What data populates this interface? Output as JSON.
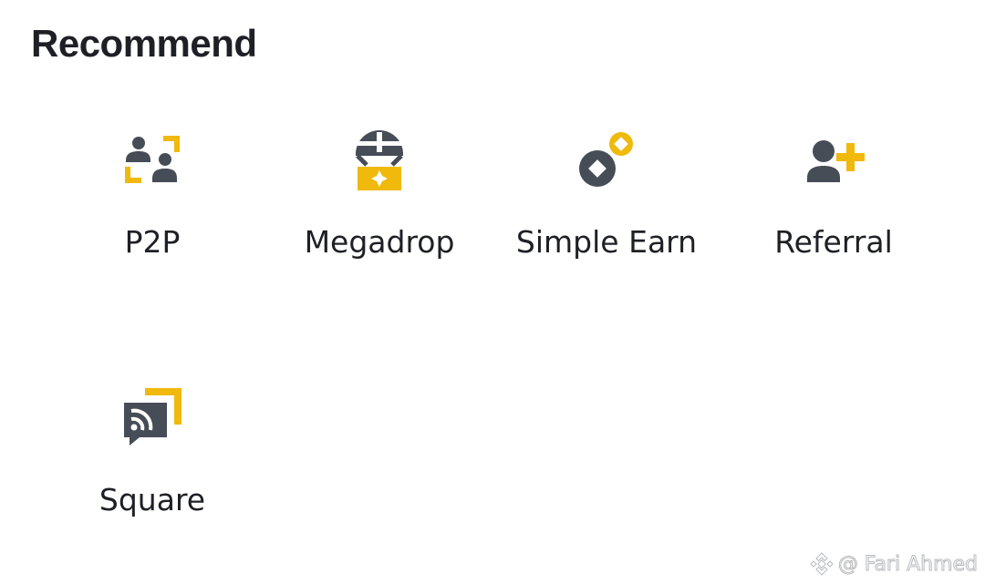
{
  "section": {
    "title": "Recommend"
  },
  "items": [
    {
      "label": "P2P",
      "icon": "p2p-icon"
    },
    {
      "label": "Megadrop",
      "icon": "megadrop-icon"
    },
    {
      "label": "Simple Earn",
      "icon": "simple-earn-icon"
    },
    {
      "label": "Referral",
      "icon": "referral-icon"
    },
    {
      "label": "Square",
      "icon": "square-icon"
    }
  ],
  "watermark": {
    "text": "@ Fari Ahmed",
    "icon": "binance-logo-icon"
  },
  "colors": {
    "accent": "#F0B90B",
    "icon_dark": "#474D57",
    "text": "#1E2026",
    "background": "#FFFFFF"
  }
}
